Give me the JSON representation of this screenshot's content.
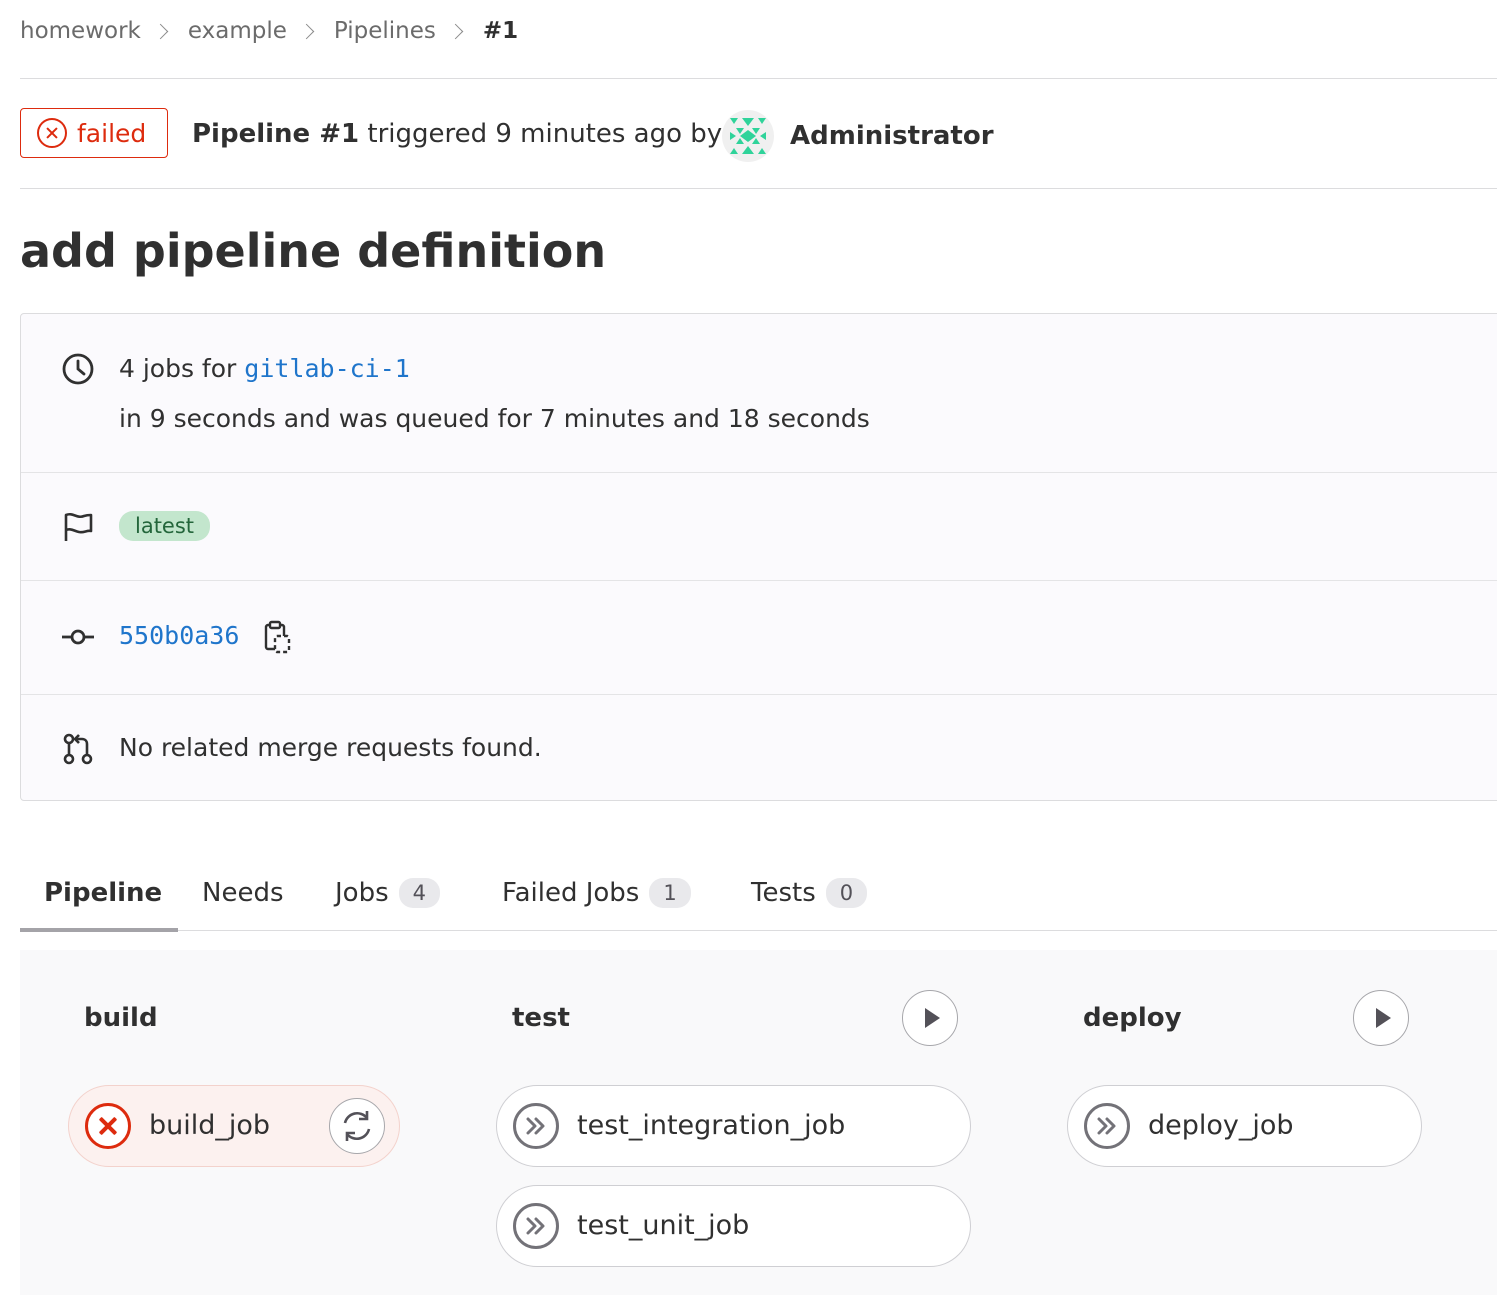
{
  "breadcrumb": {
    "items": [
      "homework",
      "example",
      "Pipelines"
    ],
    "current": "#1"
  },
  "header": {
    "status": "failed",
    "pipeline_label": "Pipeline #1",
    "triggered_text": "triggered 9 minutes ago by",
    "author": "Administrator"
  },
  "title": "add pipeline definition",
  "info": {
    "jobs_prefix": "4 jobs for",
    "branch": "gitlab-ci-1",
    "duration_text": "in 9 seconds and was queued for 7 minutes and 18 seconds",
    "label": "latest",
    "commit_sha": "550b0a36",
    "merge_requests_text": "No related merge requests found."
  },
  "tabs": [
    {
      "label": "Pipeline",
      "active": true
    },
    {
      "label": "Needs"
    },
    {
      "label": "Jobs",
      "count": "4"
    },
    {
      "label": "Failed Jobs",
      "count": "1"
    },
    {
      "label": "Tests",
      "count": "0"
    }
  ],
  "stages": [
    {
      "name": "build",
      "jobs": [
        {
          "name": "build_job",
          "status": "failed"
        }
      ]
    },
    {
      "name": "test",
      "jobs": [
        {
          "name": "test_integration_job",
          "status": "skipped"
        },
        {
          "name": "test_unit_job",
          "status": "skipped"
        }
      ]
    },
    {
      "name": "deploy",
      "jobs": [
        {
          "name": "deploy_job",
          "status": "skipped"
        }
      ]
    }
  ],
  "colors": {
    "failed": "#dd2b0e",
    "link": "#1f75cb",
    "label_bg": "#c3e6cd",
    "label_text": "#24663b"
  }
}
